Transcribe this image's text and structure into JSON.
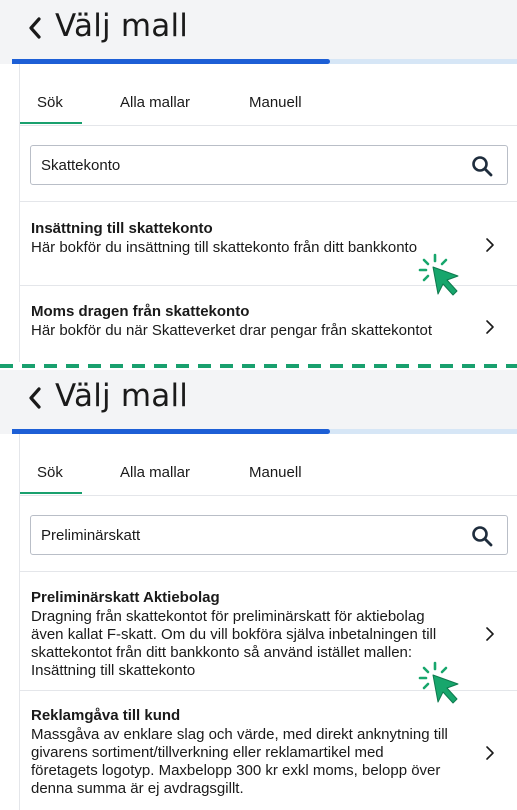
{
  "panels": [
    {
      "title": "Välj mall",
      "progress": 0.63,
      "tabs": [
        "Sök",
        "Alla mallar",
        "Manuell"
      ],
      "active_tab": "Sök",
      "search_value": "Skattekonto",
      "results": [
        {
          "title": "Insättning till skattekonto",
          "description": "Här bokför du insättning till skattekonto från ditt bankkonto"
        },
        {
          "title": "Moms dragen från skattekonto",
          "description": "Här bokför du när Skatteverket drar pengar från skattekontot"
        }
      ]
    },
    {
      "title": "Välj mall",
      "progress": 0.63,
      "tabs": [
        "Sök",
        "Alla mallar",
        "Manuell"
      ],
      "active_tab": "Sök",
      "search_value": "Preliminärskatt",
      "results": [
        {
          "title": "Preliminärskatt Aktiebolag",
          "description": "Dragning från skattekontot för preliminärskatt för aktiebolag även kallat F-skatt. Om du vill bokföra själva inbetalningen till skattekontot från ditt bankkonto så använd istället mallen: Insättning till skattekonto"
        },
        {
          "title": "Reklamgåva till kund",
          "description": "Massgåva av enklare slag och värde, med direkt anknytning till givarens sortiment/tillverkning eller reklamartikel med företagets logotyp. Maxbelopp 300 kr exkl moms, belopp över denna summa är ej avdragsgillt."
        }
      ]
    }
  ],
  "colors": {
    "accent_green": "#19a06e",
    "progress_blue": "#1d5fd6",
    "progress_track": "#d6e6f6",
    "topbar_bg": "#f3f4f6"
  },
  "icons": [
    "chevron-left-icon",
    "search-icon",
    "chevron-right-icon",
    "click-cursor-icon"
  ]
}
